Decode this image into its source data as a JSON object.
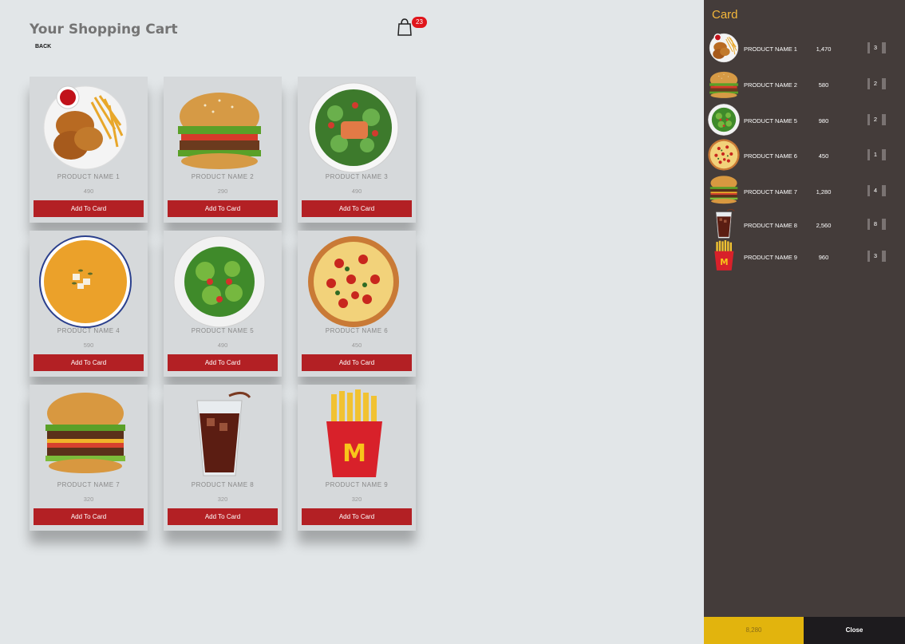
{
  "header": {
    "title": "Your Shopping Cart",
    "back_label": "BACK",
    "cart_count": "23"
  },
  "products": [
    {
      "name": "PRODUCT NAME 1",
      "price": "490",
      "button": "Add To Card",
      "icon": "fried-chicken-icon"
    },
    {
      "name": "PRODUCT NAME 2",
      "price": "290",
      "button": "Add To Card",
      "icon": "burger-icon"
    },
    {
      "name": "PRODUCT NAME 3",
      "price": "490",
      "button": "Add To Card",
      "icon": "salmon-salad-icon"
    },
    {
      "name": "PRODUCT NAME 4",
      "price": "590",
      "button": "Add To Card",
      "icon": "soup-icon"
    },
    {
      "name": "PRODUCT NAME 5",
      "price": "490",
      "button": "Add To Card",
      "icon": "green-salad-icon"
    },
    {
      "name": "PRODUCT NAME 6",
      "price": "450",
      "button": "Add To Card",
      "icon": "pizza-icon"
    },
    {
      "name": "PRODUCT NAME 7",
      "price": "320",
      "button": "Add To Card",
      "icon": "double-burger-icon"
    },
    {
      "name": "PRODUCT NAME 8",
      "price": "320",
      "button": "Add To Card",
      "icon": "cola-glass-icon"
    },
    {
      "name": "PRODUCT NAME 9",
      "price": "320",
      "button": "Add To Card",
      "icon": "fries-icon"
    }
  ],
  "sidebar": {
    "title": "Card",
    "items": [
      {
        "name": "PRODUCT NAME 1",
        "price": "1,470",
        "qty": "3",
        "icon": "fried-chicken-icon"
      },
      {
        "name": "PRODUCT NAME 2",
        "price": "580",
        "qty": "2",
        "icon": "burger-icon"
      },
      {
        "name": "PRODUCT NAME 5",
        "price": "980",
        "qty": "2",
        "icon": "green-salad-icon"
      },
      {
        "name": "PRODUCT NAME 6",
        "price": "450",
        "qty": "1",
        "icon": "pizza-icon"
      },
      {
        "name": "PRODUCT NAME 7",
        "price": "1,280",
        "qty": "4",
        "icon": "double-burger-icon"
      },
      {
        "name": "PRODUCT NAME 8",
        "price": "2,560",
        "qty": "8",
        "icon": "cola-glass-icon"
      },
      {
        "name": "PRODUCT NAME 9",
        "price": "960",
        "qty": "3",
        "icon": "fries-icon"
      }
    ],
    "total": "8,280",
    "close_label": "Close"
  },
  "colors": {
    "accent_red": "#b32024",
    "badge_red": "#e0151b",
    "sidebar_bg": "#443c3a",
    "sidebar_title": "#f4b73a",
    "total_bg": "#e2b40d",
    "close_bg": "#1d1b1e"
  }
}
